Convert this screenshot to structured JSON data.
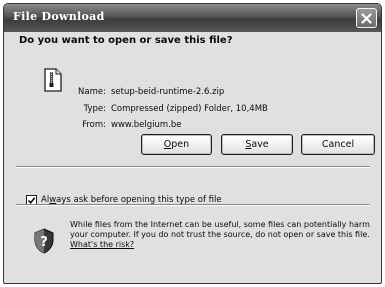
{
  "window": {
    "title": "File Download"
  },
  "dialog": {
    "question": "Do you want to open or save this file?",
    "file": {
      "name_label": "Name:",
      "name_value": "setup-beid-runtime-2.6.zip",
      "type_label": "Type:",
      "type_value": "Compressed (zipped) Folder, 10,4MB",
      "from_label": "From:",
      "from_value": "www.belgium.be"
    },
    "buttons": {
      "open": "Open",
      "save": "Save",
      "cancel": "Cancel"
    },
    "always_ask": {
      "label": "Always ask before opening this type of file",
      "checked": true
    },
    "warning": {
      "text": "While files from the Internet can be useful, some files can potentially harm your computer. If you do not trust the source, do not open or save this file.",
      "link": "What's the risk?"
    }
  },
  "icons": {
    "close": "close-icon",
    "file": "file-icon",
    "shield": "shield-icon",
    "check": "check-icon"
  }
}
